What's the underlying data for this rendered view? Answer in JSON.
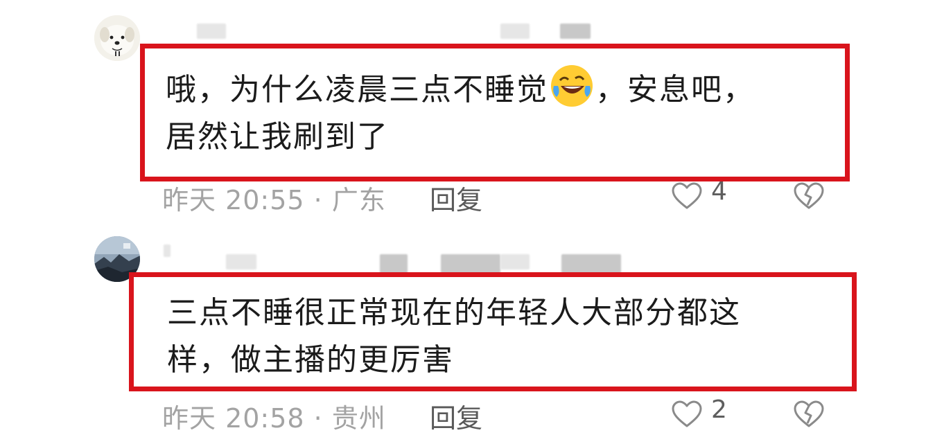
{
  "comments": [
    {
      "text_line1_a": "哦，为什么凌晨三点不睡觉",
      "emoji": "rofl-emoji",
      "text_line1_b": "，安息吧，",
      "text_line2": "居然让我刷到了",
      "meta": "昨天 20:55 · 广东",
      "reply_label": "回复",
      "likes": "4"
    },
    {
      "text_line1": "三点不睡很正常现在的年轻人大部分都这",
      "text_line2": "样，做主播的更厉害",
      "meta": "昨天 20:58 · 贵州",
      "reply_label": "回复",
      "likes": "2"
    }
  ],
  "colors": {
    "highlight_border": "#d9141c",
    "text": "#1b1b1b",
    "meta": "#a3a3a3"
  },
  "icons": [
    "avatar",
    "heart-icon",
    "broken-heart-icon",
    "rofl-emoji"
  ]
}
